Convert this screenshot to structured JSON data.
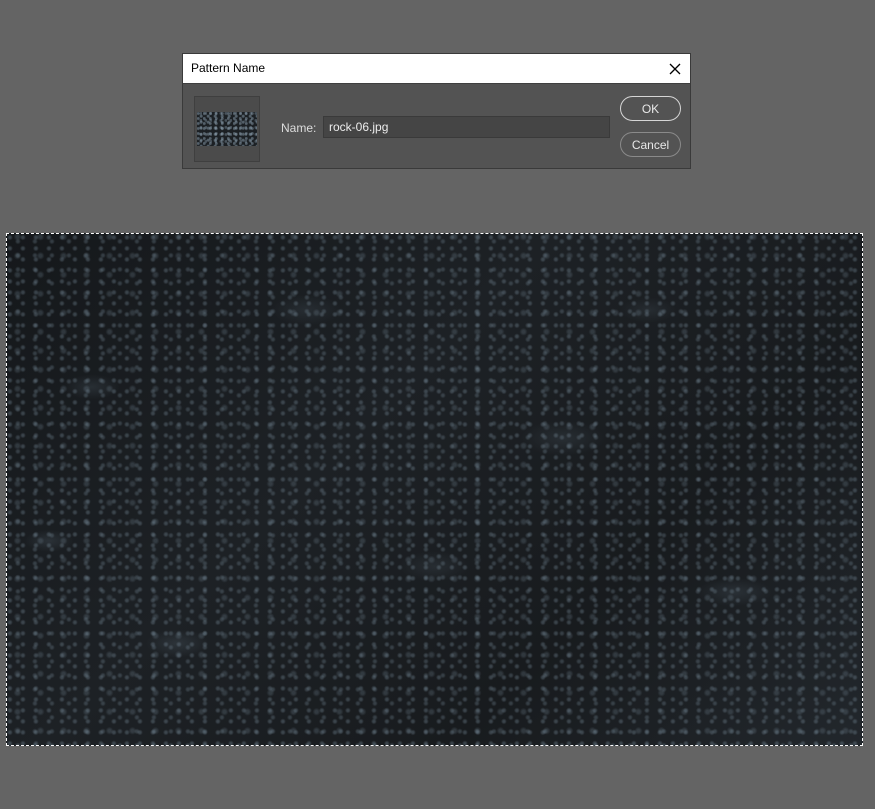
{
  "dialog": {
    "title": "Pattern Name",
    "close_icon": "close-icon",
    "name_label": "Name:",
    "name_value": "rock-06.jpg",
    "ok_label": "OK",
    "cancel_label": "Cancel"
  },
  "canvas": {
    "selection": "marching-ants"
  },
  "colors": {
    "background": "#646464",
    "dialog_bg": "#535353",
    "titlebar_bg": "#ffffff",
    "text": "#dcdcdc"
  }
}
